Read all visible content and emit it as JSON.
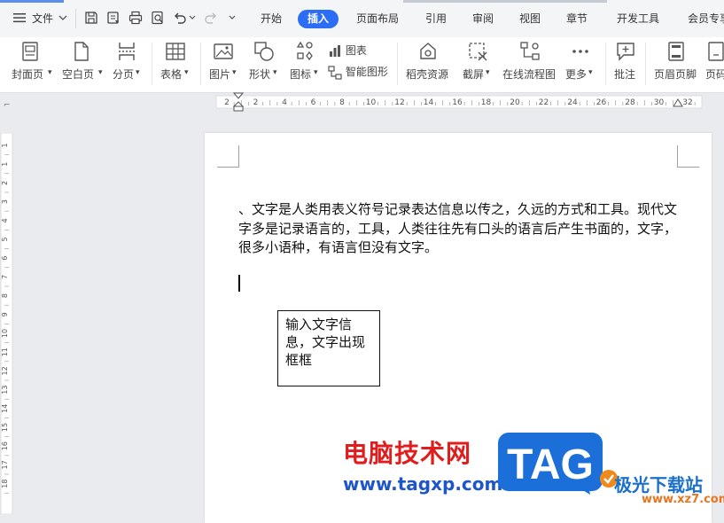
{
  "menu": {
    "file_label": "文件"
  },
  "tabs": [
    {
      "label": "开始"
    },
    {
      "label": "插入",
      "active": true
    },
    {
      "label": "页面布局"
    },
    {
      "label": "引用"
    },
    {
      "label": "审阅"
    },
    {
      "label": "视图"
    },
    {
      "label": "章节"
    },
    {
      "label": "开发工具"
    },
    {
      "label": "会员专享"
    }
  ],
  "ribbon": {
    "cover_page": "封面页",
    "blank_page": "空白页",
    "page_break": "分页",
    "table": "表格",
    "picture": "图片",
    "shape": "形状",
    "icon": "图标",
    "chart": "图表",
    "smart_graphic": "智能图形",
    "docer_resource": "稻壳资源",
    "screenshot": "截屏",
    "online_flowchart": "在线流程图",
    "more": "更多",
    "comment": "批注",
    "header_footer": "页眉页脚",
    "page_number": "页码"
  },
  "ruler": {
    "h_ticks": [
      "2",
      "2",
      "4",
      "6",
      "8",
      "10",
      "12",
      "14",
      "16",
      "18",
      "20",
      "22",
      "24",
      "26",
      "28",
      "30",
      "32"
    ],
    "v_ticks": [
      "1",
      "1",
      "2",
      "3",
      "4",
      "5",
      "6",
      "7",
      "8",
      "9",
      "10",
      "11",
      "12",
      "13",
      "14",
      "15",
      "16",
      "17",
      "18"
    ]
  },
  "document": {
    "body_text": "、文字是人类用表义符号记录表达信息以传之，久远的方式和工具。现代文字多是记录语言的，工具，人类往往先有口头的语言后产生书面的，文字，很多小语种，有语言但没有文字。",
    "textbox_text": "输入文字信息，文字出现框框"
  },
  "watermarks": {
    "site_name_cn": "电脑技术网",
    "site_url": "www.tagxp.com",
    "tag_logo": "TAG",
    "jiguang_cn": "极光下载站",
    "jiguang_url": "www.xz7.com"
  },
  "colors": {
    "accent": "#2b6ef5",
    "watermark_red": "#e01d1d",
    "watermark_blue": "#1e56c8"
  }
}
